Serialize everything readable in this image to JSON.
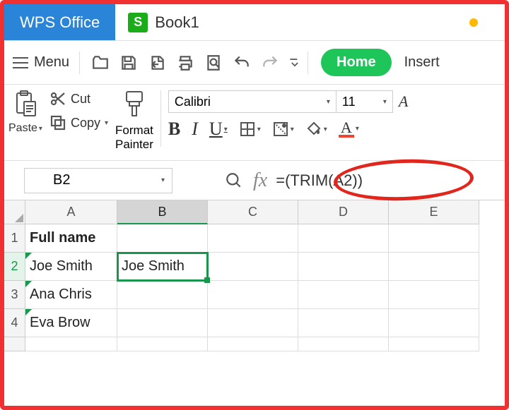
{
  "app": {
    "name": "WPS Office"
  },
  "tab": {
    "icon_letter": "S",
    "title": "Book1"
  },
  "menu": {
    "label": "Menu"
  },
  "ribbon_tabs": {
    "home": "Home",
    "insert": "Insert"
  },
  "clipboard": {
    "paste": "Paste",
    "cut": "Cut",
    "copy": "Copy",
    "format_painter_l1": "Format",
    "format_painter_l2": "Painter"
  },
  "font": {
    "name": "Calibri",
    "size": "11"
  },
  "name_box": "B2",
  "formula": "=(TRIM(A2))",
  "columns": [
    "A",
    "B",
    "C",
    "D",
    "E"
  ],
  "rows": [
    "1",
    "2",
    "3",
    "4"
  ],
  "cells": {
    "A1": "Full name",
    "A2": " Joe Smith",
    "A3": " Ana Chris",
    "A4": " Eva Brow",
    "B2": "Joe Smith"
  }
}
